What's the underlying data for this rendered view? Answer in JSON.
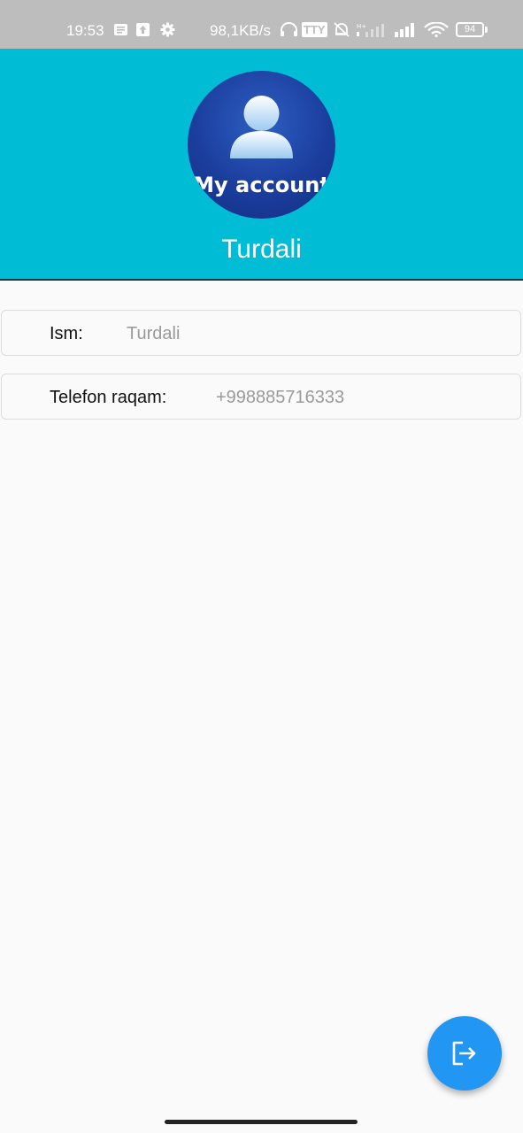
{
  "status_bar": {
    "time": "19:53",
    "net_speed": "98,1KB/s",
    "tty": "TTY",
    "battery": "94",
    "icons": [
      "message-icon",
      "upload-icon",
      "gear-icon",
      "headphones-icon",
      "bell-off-icon",
      "signal-icon",
      "signal-icon",
      "wifi-icon",
      "battery-icon"
    ]
  },
  "header": {
    "avatar_label": "My account",
    "user_name": "Turdali",
    "background": "#00bcd4"
  },
  "fields": {
    "name_label": "Ism:",
    "name_value": "Turdali",
    "phone_label": "Telefon raqam:",
    "phone_value": "+998885716333"
  },
  "fab": {
    "icon": "logout-icon",
    "color": "#2196f3"
  }
}
